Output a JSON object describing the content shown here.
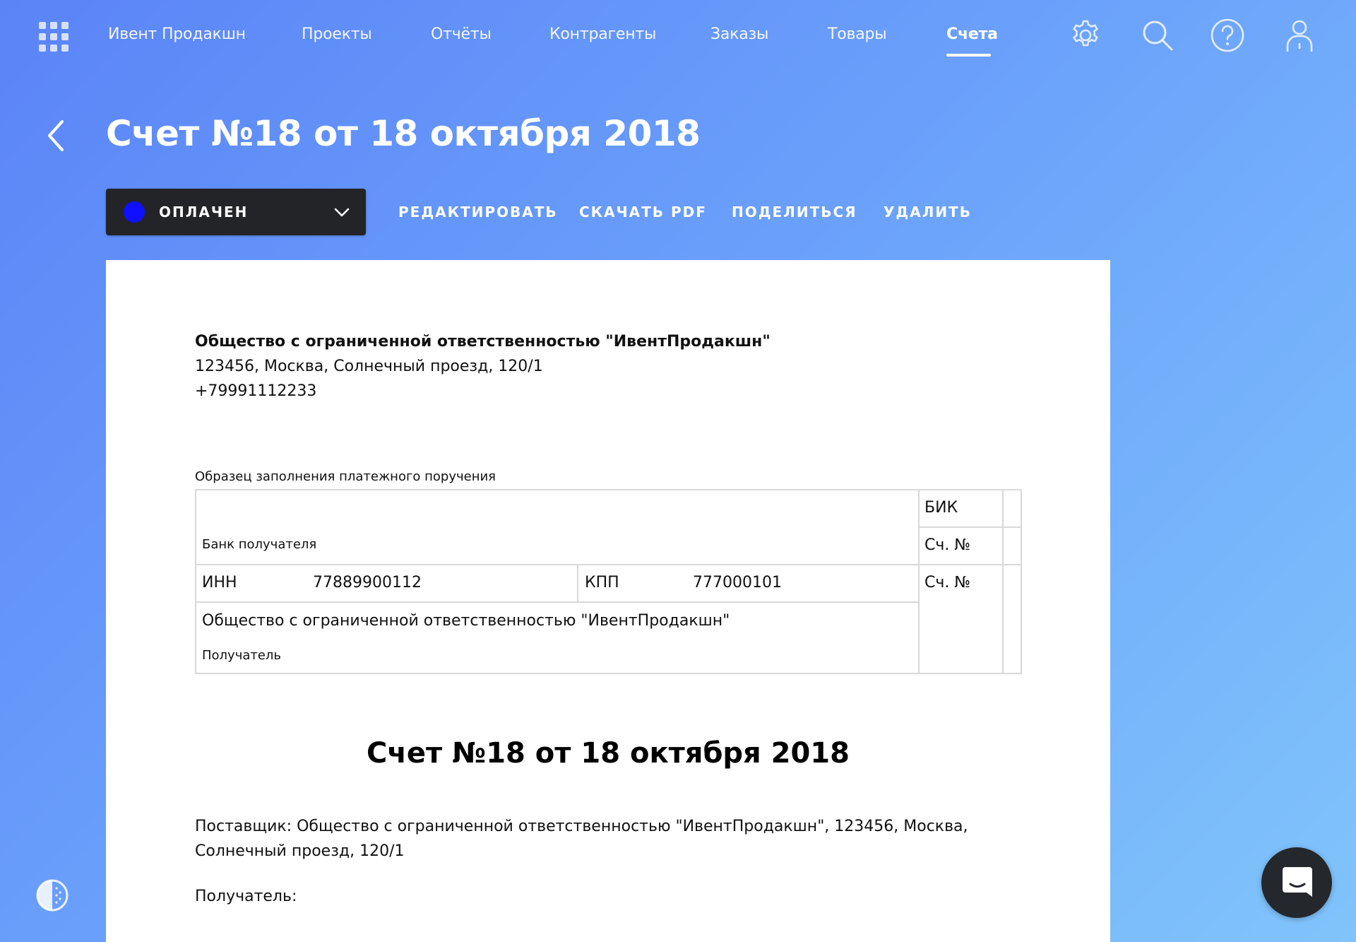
{
  "nav": {
    "items": [
      "Ивент Продакшн",
      "Проекты",
      "Отчёты",
      "Контрагенты",
      "Заказы",
      "Товары",
      "Счета"
    ],
    "active": "Счета"
  },
  "page": {
    "title": "Счет №18 от 18 октября 2018"
  },
  "toolbar": {
    "status_label": "ОПЛАЧЕН",
    "status_color": "#1010ff",
    "edit_label": "РЕДАКТИРОВАТЬ",
    "download_label": "СКАЧАТЬ PDF",
    "share_label": "ПОДЕЛИТЬСЯ",
    "delete_label": "УДАЛИТЬ"
  },
  "document": {
    "company_name": "Общество с ограниченной ответственностью \"ИвентПродакшн\"",
    "company_address": "123456, Москва, Солнечный проезд, 120/1",
    "company_phone": "+79991112233",
    "sample_label": "Образец заполнения платежного поручения",
    "table": {
      "bank_label": "Банк получателя",
      "bik_label": "БИК",
      "account_label_1": "Сч. №",
      "account_label_2": "Сч. №",
      "inn_label": "ИНН",
      "inn_value": "77889900112",
      "kpp_label": "КПП",
      "kpp_value": "777000101",
      "recipient_name": "Общество с ограниченной ответственностью \"ИвентПродакшн\"",
      "recipient_label": "Получатель"
    },
    "invoice_heading": "Счет №18 от 18 октября 2018",
    "supplier_line": "Поставщик: Общество с ограниченной ответственностью \"ИвентПродакшн\", 123456, Москва, Солнечный проезд, 120/1",
    "recipient_line": "Получатель:"
  },
  "icons": [
    "apps-grid-icon",
    "gear-icon",
    "search-icon",
    "help-icon",
    "user-icon",
    "back-arrow-icon",
    "chevron-down-icon",
    "theme-toggle-icon",
    "chat-icon"
  ]
}
